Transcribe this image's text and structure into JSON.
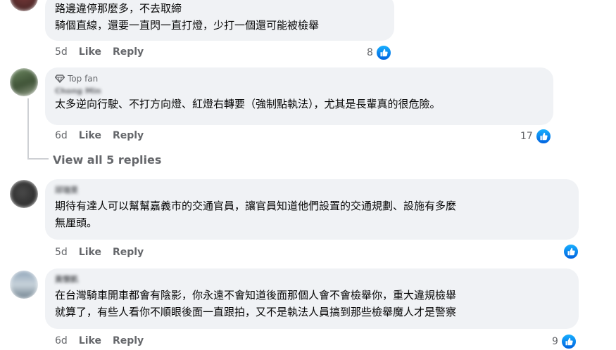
{
  "comments": [
    {
      "name": "",
      "text_lines": [
        "路邊違停那麼多，不去取締",
        "騎個直線，還要一直閃一直打燈，少打一個還可能被檢舉"
      ],
      "time": "5d",
      "like_label": "Like",
      "reply_label": "Reply",
      "reactions": "8"
    },
    {
      "badge": "Top fan",
      "name": "Chong Min",
      "text_lines": [
        "太多逆向行駛、不打方向燈、紅燈右轉要（強制點執法），尤其是長輩真的很危險。"
      ],
      "time": "6d",
      "like_label": "Like",
      "reply_label": "Reply",
      "reactions": "17"
    },
    {
      "name": "邱瑞旻",
      "text_lines": [
        "期待有達人可以幫幫嘉義市的交通官員，讓官員知道他們設置的交通規劃、設施有多麼",
        "無厘頭。"
      ],
      "time": "5d",
      "like_label": "Like",
      "reply_label": "Reply",
      "reactions": ""
    },
    {
      "name": "黃懷凱",
      "text_lines": [
        "在台灣騎車開車都會有陰影，你永遠不會知道後面那個人會不會檢舉你，重大違規檢舉",
        "就算了，有些人看你不順眼後面一直跟拍，又不是執法人員搞到那些檢舉魔人才是警察"
      ],
      "time": "6d",
      "like_label": "Like",
      "reply_label": "Reply",
      "reactions": "9"
    }
  ],
  "view_replies": "View all 5 replies",
  "colors": {
    "bubble": "#f0f2f5",
    "meta": "#65676b",
    "like_blue": "#0866ff"
  },
  "icons": {
    "reaction": "thumbs-up-icon",
    "top_fan": "diamond-icon"
  }
}
